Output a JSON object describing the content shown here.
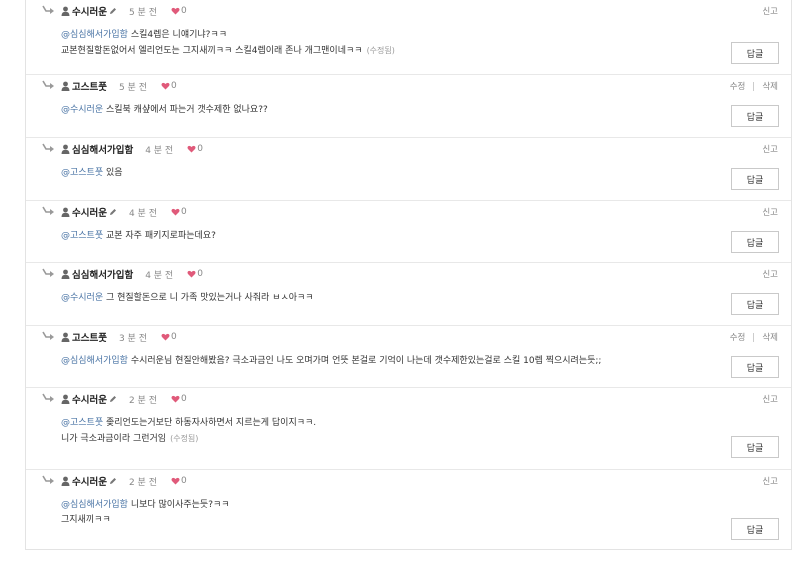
{
  "colors": {
    "mention": "#4a74a5",
    "heart": "#e05a7a",
    "meta": "#888888"
  },
  "icons": {
    "reply": "reply-arrow-icon",
    "user": "user-icon",
    "verified": "pencil-icon",
    "like": "heart-icon"
  },
  "comments": [
    {
      "author": "수시러운",
      "pencil": true,
      "time": "5 분 전",
      "likes": "0",
      "actions": [
        "신고"
      ],
      "mention": "@심심해서가입함",
      "line1": " 스킬4렙은 니얘기냐?ㅋㅋ",
      "line2": "교본현질할돈없어서 엘리언도는 그지새끼ㅋㅋ 스킬4렙이래 존나 개그맨이네ㅋㅋ",
      "edited": "(수정됨)",
      "reply": "답글"
    },
    {
      "author": "고스트풋",
      "pencil": false,
      "time": "5 분 전",
      "likes": "0",
      "actions": [
        "수정",
        "삭제"
      ],
      "mention": "@수시러운",
      "line1": " 스킬북 캐샾에서 파는거 갯수제한 없나요??",
      "reply": "답글"
    },
    {
      "author": "심심해서가입함",
      "pencil": false,
      "time": "4 분 전",
      "likes": "0",
      "actions": [
        "신고"
      ],
      "mention": "@고스트풋",
      "line1": " 있음",
      "reply": "답글"
    },
    {
      "author": "수시러운",
      "pencil": true,
      "time": "4 분 전",
      "likes": "0",
      "actions": [
        "신고"
      ],
      "mention": "@고스트풋",
      "line1": " 교본 자주 패키지로파는데요?",
      "reply": "답글"
    },
    {
      "author": "심심해서가입함",
      "pencil": false,
      "time": "4 분 전",
      "likes": "0",
      "actions": [
        "신고"
      ],
      "mention": "@수시러운",
      "line1": " 그 현질할돈으로 니 가족 맛있는거나 사줘라 ㅂㅅ아ㅋㅋ",
      "reply": "답글"
    },
    {
      "author": "고스트풋",
      "pencil": false,
      "time": "3 분 전",
      "likes": "0",
      "actions": [
        "수정",
        "삭제"
      ],
      "mention": "@심심해서가입함",
      "line1": " 수시러운님 현질안해봤음? 극소과금인 나도 오며가며 언뜻 본걸로 기억이 나는데 갯수제한있는걸로 스킬 10렙 찍으시려는듯;;",
      "reply": "답글"
    },
    {
      "author": "수시러운",
      "pencil": true,
      "time": "2 분 전",
      "likes": "0",
      "actions": [
        "신고"
      ],
      "mention": "@고스트풋",
      "line1": " 좆리언도는거보단 하동자사하면서 지르는게 답이지ㅋㅋ.",
      "line2": "니가 극소과금이라 그런거임",
      "edited": "(수정됨)",
      "reply": "답글"
    },
    {
      "author": "수시러운",
      "pencil": true,
      "time": "2 분 전",
      "likes": "0",
      "actions": [
        "신고"
      ],
      "mention": "@심심해서가입함",
      "line1": " 니보다 많이사주는듯?ㅋㅋ",
      "line2": "그지새끼ㅋㅋ",
      "reply": "답글"
    }
  ]
}
